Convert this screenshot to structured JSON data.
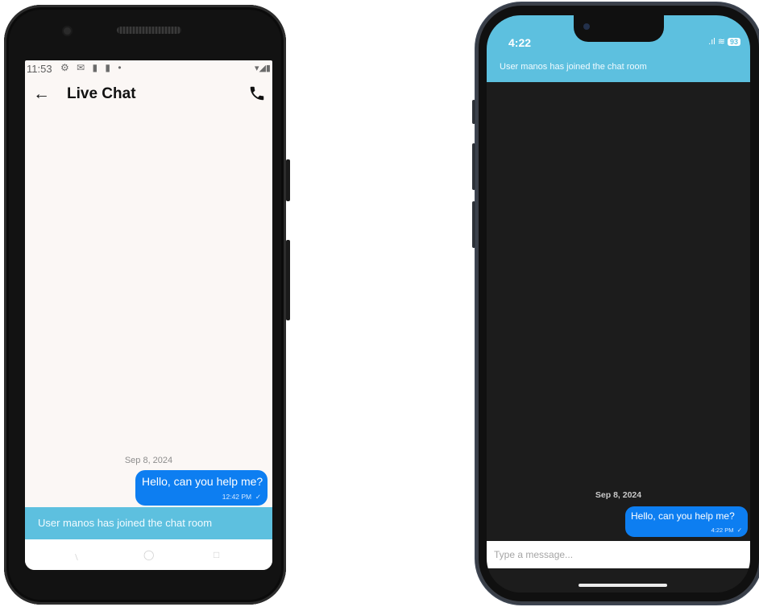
{
  "android": {
    "status_time": "11:53",
    "title": "Live Chat",
    "date_separator": "Sep 8, 2024",
    "message": {
      "text": "Hello, can you help me?",
      "time": "12:42 PM",
      "status": "✓"
    },
    "banner": "User manos has joined the chat room"
  },
  "iphone": {
    "status_time": "4:22",
    "battery": "93",
    "banner": "User manos has joined the chat room",
    "date_separator": "Sep 8, 2024",
    "message": {
      "text": "Hello, can you help me?",
      "time": "4:22 PM",
      "status": "✓"
    },
    "input_placeholder": "Type a message..."
  },
  "colors": {
    "accent": "#5dc0df",
    "bubble": "#0d7ef1"
  },
  "icons": [
    "back-arrow-icon",
    "phone-call-icon",
    "wifi-icon",
    "battery-icon"
  ]
}
